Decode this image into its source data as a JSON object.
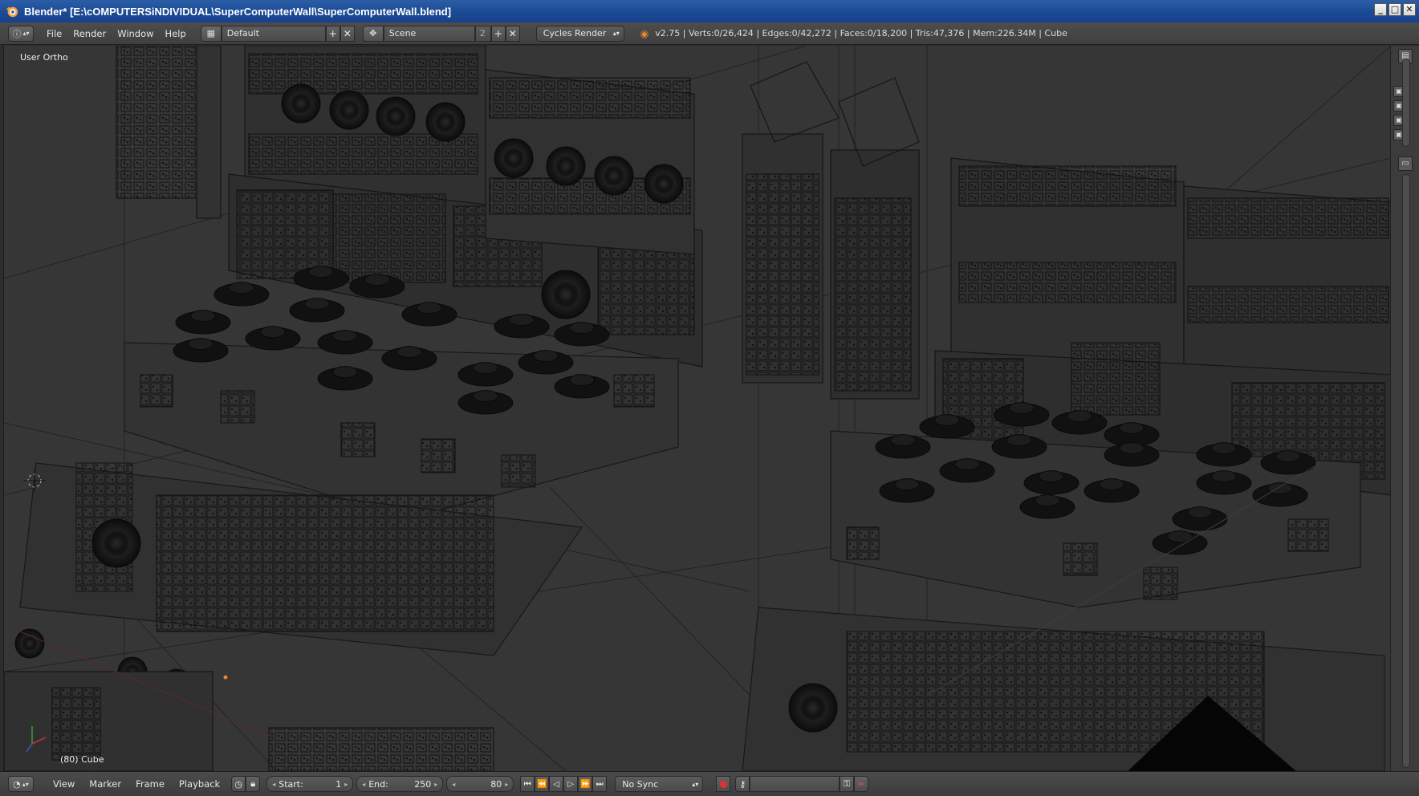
{
  "window": {
    "title": "Blender* [E:\\cOMPUTERSiNDIVIDUAL\\SuperComputerWall\\SuperComputerWall.blend]",
    "minimize": "_",
    "maximize": "□",
    "close": "✕"
  },
  "info_header": {
    "menus": [
      "File",
      "Render",
      "Window",
      "Help"
    ],
    "screen_layout": "Default",
    "scene": "Scene",
    "scene_users": "2",
    "render_engine": "Cycles Render",
    "stats": "v2.75 | Verts:0/26,424 | Edges:0/42,272 | Faces:0/18,200 | Tris:47,376 | Mem:226.34M | Cube"
  },
  "viewport": {
    "view_name": "User Ortho",
    "active_object": "(80) Cube"
  },
  "timeline": {
    "menus": [
      "View",
      "Marker",
      "Frame",
      "Playback"
    ],
    "start_label": "Start:",
    "start_value": "1",
    "end_label": "End:",
    "end_value": "250",
    "current_frame": "80",
    "sync_mode": "No Sync"
  },
  "icons": {
    "editor_type": "info-icon",
    "layout": "screen-layout-icon",
    "scene": "scene-icon",
    "timeline_editor": "timeline-icon",
    "record": "record-icon",
    "keying": "keying-set-icon"
  },
  "colors": {
    "titlebar": "#1b4a94",
    "viewport_bg": "#363636",
    "wire": "#111111",
    "header": "#444444"
  }
}
